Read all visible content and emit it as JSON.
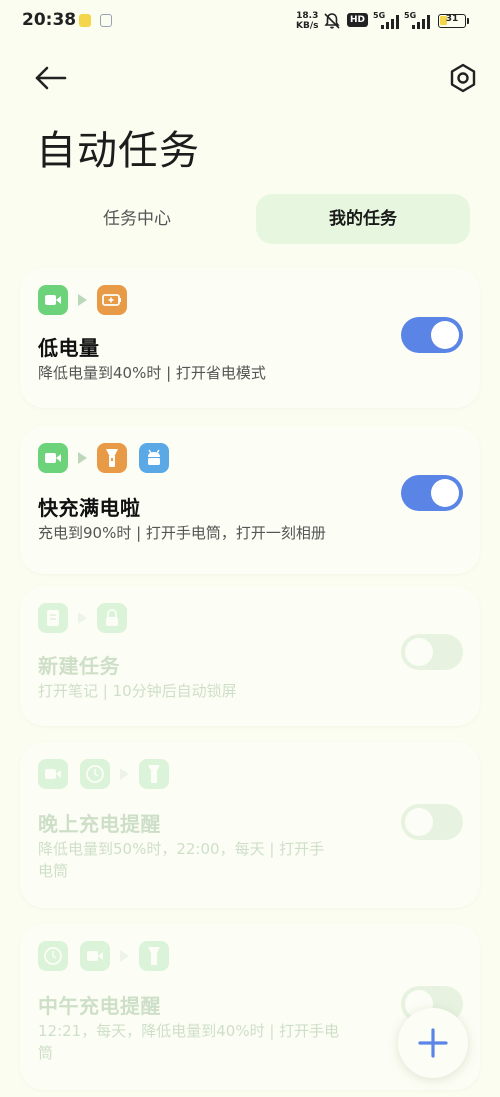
{
  "status_bar": {
    "time": "20:38",
    "speed_top": "18.3",
    "speed_bottom": "KB/s",
    "hd": "HD",
    "net1": "5G",
    "net2": "5G",
    "battery": "31",
    "battery_level": 0.31
  },
  "header": {
    "title": "自动任务"
  },
  "tabs": [
    {
      "label": "任务中心",
      "selected": false
    },
    {
      "label": "我的任务",
      "selected": true
    }
  ],
  "tasks": [
    {
      "title": "低电量",
      "desc": "降低电量到40%时 | 打开省电模式",
      "enabled": true,
      "icons": [
        "video-icon",
        "battery-saver-icon"
      ]
    },
    {
      "title": "快充满电啦",
      "desc": "充电到90%时 | 打开手电筒，打开一刻相册",
      "enabled": true,
      "icons": [
        "video-icon",
        "flashlight-icon",
        "android-icon"
      ]
    },
    {
      "title": "新建任务",
      "desc": "打开笔记 | 10分钟后自动锁屏",
      "enabled": false,
      "icons": [
        "note-icon",
        "lock-icon"
      ]
    },
    {
      "title": "晚上充电提醒",
      "desc_line1": "降低电量到50%时，22:00，每天 | 打开手",
      "desc_line2": "电筒",
      "enabled": false,
      "icons": [
        "video-icon",
        "clock-icon",
        "flashlight-icon"
      ]
    },
    {
      "title": "中午充电提醒",
      "desc_line1": "12:21，每天，降低电量到40%时 | 打开手电",
      "desc_line2": "筒",
      "enabled": false,
      "icons": [
        "clock-icon",
        "video-icon",
        "flashlight-icon"
      ]
    }
  ],
  "colors": {
    "accent": "#5a84e6",
    "green_icon": "#6cd37a",
    "orange_icon": "#e99a46",
    "blue_icon": "#5aa9e6",
    "tab_selected_bg": "#e7f7df"
  }
}
